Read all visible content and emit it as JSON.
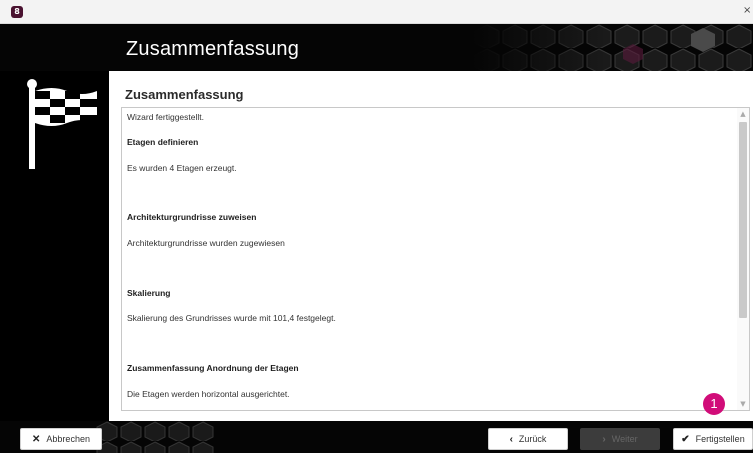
{
  "window": {
    "app_icon_label": "8",
    "close_glyph": "×"
  },
  "header": {
    "title": "Zusammenfassung"
  },
  "content": {
    "heading": "Zusammenfassung",
    "lines": [
      "Wizard fertiggestellt.",
      "Etagen definieren",
      "Es wurden 4 Etagen erzeugt.",
      "Architekturgrundrisse zuweisen",
      "Architekturgrundrisse wurden zugewiesen",
      "Skalierung",
      "Skalierung des Grundrisses wurde mit 101,4 festgelegt.",
      "Zusammenfassung Anordnung der Etagen",
      "Die Etagen werden horizontal ausgerichtet."
    ]
  },
  "callout": {
    "number": "1"
  },
  "footer": {
    "cancel": {
      "label": "Abbrechen",
      "icon": "x-icon"
    },
    "back": {
      "label": "Zurück",
      "icon": "chevron-left-icon"
    },
    "next": {
      "label": "Weiter",
      "icon": "chevron-right-icon",
      "enabled": false
    },
    "finish": {
      "label": "Fertigstellen",
      "icon": "check-icon"
    }
  },
  "colors": {
    "accent_badge": "#d10d79",
    "background": "#050505",
    "hex_tint": "#2a2a2a"
  }
}
